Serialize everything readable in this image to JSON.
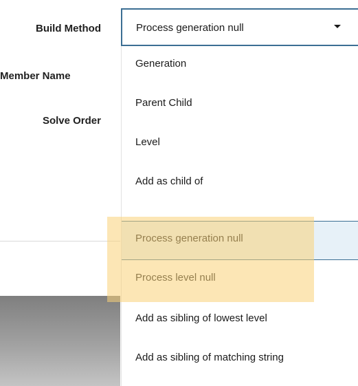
{
  "form": {
    "labels": {
      "build_method": "Build Method",
      "member_name": "Member Name",
      "solve_order": "Solve Order"
    }
  },
  "select": {
    "value": "Process generation null",
    "icon": "caret-down-icon"
  },
  "dropdown": {
    "options": [
      "Generation",
      "Parent Child",
      "Level",
      "Add as child of",
      "Process generation null",
      "Process level null",
      "Add as sibling of lowest level",
      "Add as sibling of matching string"
    ],
    "selected_index": 4
  },
  "colors": {
    "accent": "#3b6e93",
    "selected_bg": "#e7f1f8",
    "highlight": "#fad278"
  }
}
